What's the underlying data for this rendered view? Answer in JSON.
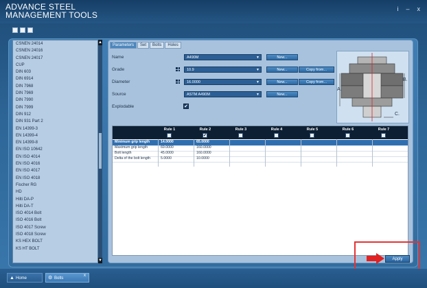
{
  "window": {
    "title_line1": "ADVANCE STEEL",
    "title_line2": "MANAGEMENT TOOLS",
    "btn_info": "i",
    "btn_min": "–",
    "btn_close": "x"
  },
  "toolbar": {
    "icons": [
      "folder-icon",
      "save-icon",
      "grid-icon"
    ]
  },
  "list": {
    "items": [
      "CSNEN 24014",
      "CSNEN 24016",
      "CSNEN 24017",
      "CUP",
      "DIN 603",
      "DIN 6914",
      "DIN 7968",
      "DIN 7969",
      "DIN 7990",
      "DIN 7999",
      "DIN 912",
      "DIN 931 Part 2",
      "EN 14399-3",
      "EN 14399-4",
      "EN 14399-8",
      "EN ISO 10642",
      "EN ISO 4014",
      "EN ISO 4016",
      "EN ISO 4017",
      "EN ISO 4018",
      "Fischer RG",
      "HD",
      "Hilti DA-P",
      "Hilti DA-T",
      "ISO 4014 Bolt",
      "ISO 4016 Bolt",
      "ISO 4017 Screw",
      "ISO 4018 Screw",
      "KS HEX BOLT",
      "KS HT BOLT"
    ]
  },
  "tabs": [
    "Parameters",
    "Set",
    "Bolts",
    "Holes"
  ],
  "form": {
    "name_label": "Name",
    "name_value": "A490M",
    "grade_label": "Grade",
    "grade_value": "10.9",
    "diameter_label": "Diameter",
    "diameter_value": "16.0000",
    "source_label": "Source",
    "source_value": "ASTM A490M",
    "explodable_label": "Explodable",
    "explodable_checked": "✔",
    "new_label": "New...",
    "copy_label": "Copy from..."
  },
  "diagram": {
    "label_a": "A.",
    "label_b": "B.",
    "label_c": "C."
  },
  "table": {
    "headers": [
      "Rule 1",
      "Rule 2",
      "Rule 3",
      "Rule 4",
      "Rule 5",
      "Rule 6",
      "Rule 7"
    ],
    "rule2_check": "✔",
    "rows": [
      {
        "label": "Minimum grip length",
        "r1": "14.0000",
        "r2": "65.0000"
      },
      {
        "label": "Maximum grip length",
        "r1": "69.0000",
        "r2": "160.0000"
      },
      {
        "label": "Bolt length",
        "r1": "45.0000",
        "r2": "160.0000"
      },
      {
        "label": "Delta of the bolt length",
        "r1": "5.0000",
        "r2": "10.0000"
      }
    ]
  },
  "apply_label": "Apply",
  "bottom_tabs": {
    "home": "Home",
    "bolts": "Bolts",
    "close": "x"
  }
}
